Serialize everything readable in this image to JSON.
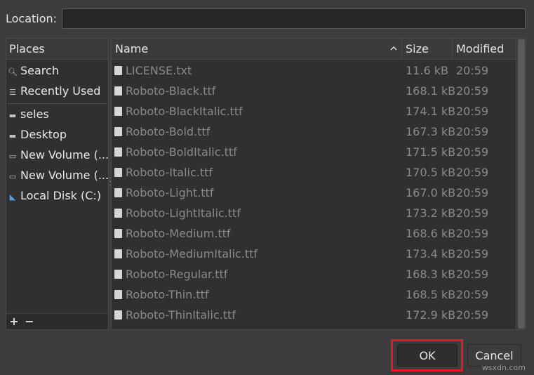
{
  "location": {
    "label": "Location:",
    "value": ""
  },
  "places": {
    "header": "Places",
    "items": [
      {
        "label": "Search",
        "icon": "search-icon"
      },
      {
        "label": "Recently Used",
        "icon": "recent-icon"
      },
      {
        "label": "seles",
        "icon": "folder-icon"
      },
      {
        "label": "Desktop",
        "icon": "folder-icon"
      },
      {
        "label": "New Volume (...",
        "icon": "drive-icon"
      },
      {
        "label": "New Volume (...",
        "icon": "drive-icon"
      },
      {
        "label": "Local Disk (C:)",
        "icon": "system-drive-icon"
      }
    ],
    "add_label": "+",
    "remove_label": "−"
  },
  "files": {
    "columns": {
      "name": "Name",
      "size": "Size",
      "modified": "Modified"
    },
    "sort": "name-ascending",
    "rows": [
      {
        "name": "LICENSE.txt",
        "size": "11.6 kB",
        "modified": "20:59"
      },
      {
        "name": "Roboto-Black.ttf",
        "size": "168.1 kB",
        "modified": "20:59"
      },
      {
        "name": "Roboto-BlackItalic.ttf",
        "size": "174.1 kB",
        "modified": "20:59"
      },
      {
        "name": "Roboto-Bold.ttf",
        "size": "167.3 kB",
        "modified": "20:59"
      },
      {
        "name": "Roboto-BoldItalic.ttf",
        "size": "171.5 kB",
        "modified": "20:59"
      },
      {
        "name": "Roboto-Italic.ttf",
        "size": "170.5 kB",
        "modified": "20:59"
      },
      {
        "name": "Roboto-Light.ttf",
        "size": "167.0 kB",
        "modified": "20:59"
      },
      {
        "name": "Roboto-LightItalic.ttf",
        "size": "173.2 kB",
        "modified": "20:59"
      },
      {
        "name": "Roboto-Medium.ttf",
        "size": "168.6 kB",
        "modified": "20:59"
      },
      {
        "name": "Roboto-MediumItalic.ttf",
        "size": "173.4 kB",
        "modified": "20:59"
      },
      {
        "name": "Roboto-Regular.ttf",
        "size": "168.3 kB",
        "modified": "20:59"
      },
      {
        "name": "Roboto-Thin.ttf",
        "size": "168.5 kB",
        "modified": "20:59"
      },
      {
        "name": "Roboto-ThinItalic.ttf",
        "size": "172.9 kB",
        "modified": "20:59"
      }
    ]
  },
  "buttons": {
    "ok": "OK",
    "cancel": "Cancel"
  },
  "watermark": "wsxdn.com",
  "colors": {
    "highlight": "#e01b24",
    "background": "#3c3c3c",
    "panel": "#303030"
  }
}
